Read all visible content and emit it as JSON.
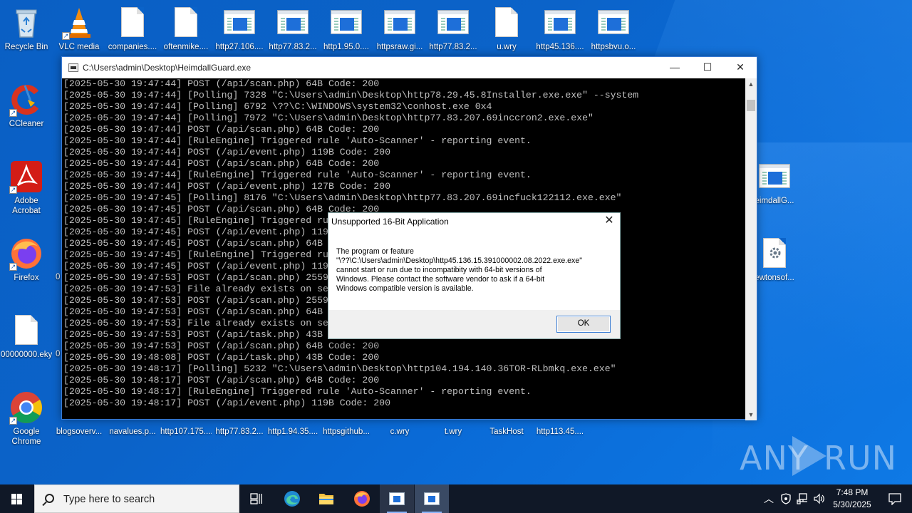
{
  "desktop": {
    "top_icons": [
      {
        "label": "Recycle Bin"
      },
      {
        "label": "VLC media"
      },
      {
        "label": "companies...."
      },
      {
        "label": "oftenmike...."
      },
      {
        "label": "http27.106...."
      },
      {
        "label": "http77.83.2..."
      },
      {
        "label": "http1.95.0...."
      },
      {
        "label": "httpsraw.gi..."
      },
      {
        "label": "http77.83.2..."
      },
      {
        "label": "u.wry"
      },
      {
        "label": "http45.136...."
      },
      {
        "label": "httpsbvu.o..."
      }
    ],
    "left_icons": [
      {
        "label": "CCleaner"
      },
      {
        "label": "Adobe Acrobat"
      },
      {
        "label": "Firefox"
      },
      {
        "label": "00000000.eky"
      },
      {
        "label": "Google Chrome"
      }
    ],
    "bottom_icons": [
      {
        "label": "blogsoverv..."
      },
      {
        "label": "navalues.p..."
      },
      {
        "label": "http107.175...."
      },
      {
        "label": "http77.83.2..."
      },
      {
        "label": "http1.94.35...."
      },
      {
        "label": "httpsgithub..."
      },
      {
        "label": "c.wry"
      },
      {
        "label": "t.wry"
      },
      {
        "label": "TaskHost"
      },
      {
        "label": "http113.45...."
      }
    ],
    "right_icons": [
      {
        "label": "eimdallG..."
      },
      {
        "label": "ewtonsof..."
      }
    ],
    "partial_labels": [
      "0",
      "0"
    ]
  },
  "console": {
    "title": "C:\\Users\\admin\\Desktop\\HeimdallGuard.exe",
    "minimize": "—",
    "maximize": "☐",
    "close": "✕",
    "lines": [
      "[2025-05-30 19:47:44] POST (/api/scan.php) 64B Code: 200",
      "[2025-05-30 19:47:44] [Polling] 7328 \"C:\\Users\\admin\\Desktop\\http78.29.45.8Installer.exe.exe\" --system",
      "[2025-05-30 19:47:44] [Polling] 6792 \\??\\C:\\WINDOWS\\system32\\conhost.exe 0x4",
      "[2025-05-30 19:47:44] [Polling] 7972 \"C:\\Users\\admin\\Desktop\\http77.83.207.69inccron2.exe.exe\"",
      "[2025-05-30 19:47:44] POST (/api/scan.php) 64B Code: 200",
      "[2025-05-30 19:47:44] [RuleEngine] Triggered rule 'Auto-Scanner' - reporting event.",
      "[2025-05-30 19:47:44] POST (/api/event.php) 119B Code: 200",
      "[2025-05-30 19:47:44] POST (/api/scan.php) 64B Code: 200",
      "[2025-05-30 19:47:44] [RuleEngine] Triggered rule 'Auto-Scanner' - reporting event.",
      "[2025-05-30 19:47:44] POST (/api/event.php) 127B Code: 200",
      "[2025-05-30 19:47:45] [Polling] 8176 \"C:\\Users\\admin\\Desktop\\http77.83.207.69incfuck122112.exe.exe\"",
      "[2025-05-30 19:47:45] POST (/api/scan.php) 64B Code: 200",
      "[2025-05-30 19:47:45] [RuleEngine] Triggered ru",
      "[2025-05-30 19:47:45] POST (/api/event.php) 119",
      "[2025-05-30 19:47:45] POST (/api/scan.php) 64B",
      "[2025-05-30 19:47:45] [RuleEngine] Triggered ru",
      "[2025-05-30 19:47:45] POST (/api/event.php) 119",
      "[2025-05-30 19:47:53] POST (/api/scan.php) 2559",
      "[2025-05-30 19:47:53] File already exists on se",
      "[2025-05-30 19:47:53] POST (/api/scan.php) 2559",
      "[2025-05-30 19:47:53] POST (/api/scan.php) 64B",
      "[2025-05-30 19:47:53] File already exists on se",
      "[2025-05-30 19:47:53] POST (/api/task.php) 43B",
      "[2025-05-30 19:47:53] POST (/api/scan.php) 64B Code: 200",
      "[2025-05-30 19:48:08] POST (/api/task.php) 43B Code: 200",
      "[2025-05-30 19:48:17] [Polling] 5232 \"C:\\Users\\admin\\Desktop\\http104.194.140.36TOR-RLbmkq.exe.exe\"",
      "[2025-05-30 19:48:17] POST (/api/scan.php) 64B Code: 200",
      "[2025-05-30 19:48:17] [RuleEngine] Triggered rule 'Auto-Scanner' - reporting event.",
      "[2025-05-30 19:48:17] POST (/api/event.php) 119B Code: 200"
    ]
  },
  "dialog": {
    "title": "Unsupported 16-Bit Application",
    "close": "✕",
    "message_lines": [
      "The program or feature",
      "\"\\??\\C:\\Users\\admin\\Desktop\\http45.136.15.391000002.08.2022.exe.exe\"",
      "cannot start or run due to incompatibity with 64-bit versions of",
      "Windows. Please contact the software vendor to ask if a 64-bit",
      "Windows compatible version is available."
    ],
    "ok_label": "OK"
  },
  "watermark": {
    "left": "ANY",
    "right": "RUN"
  },
  "taskbar": {
    "search_placeholder": "Type here to search",
    "time": "7:48 PM",
    "date": "5/30/2025"
  }
}
